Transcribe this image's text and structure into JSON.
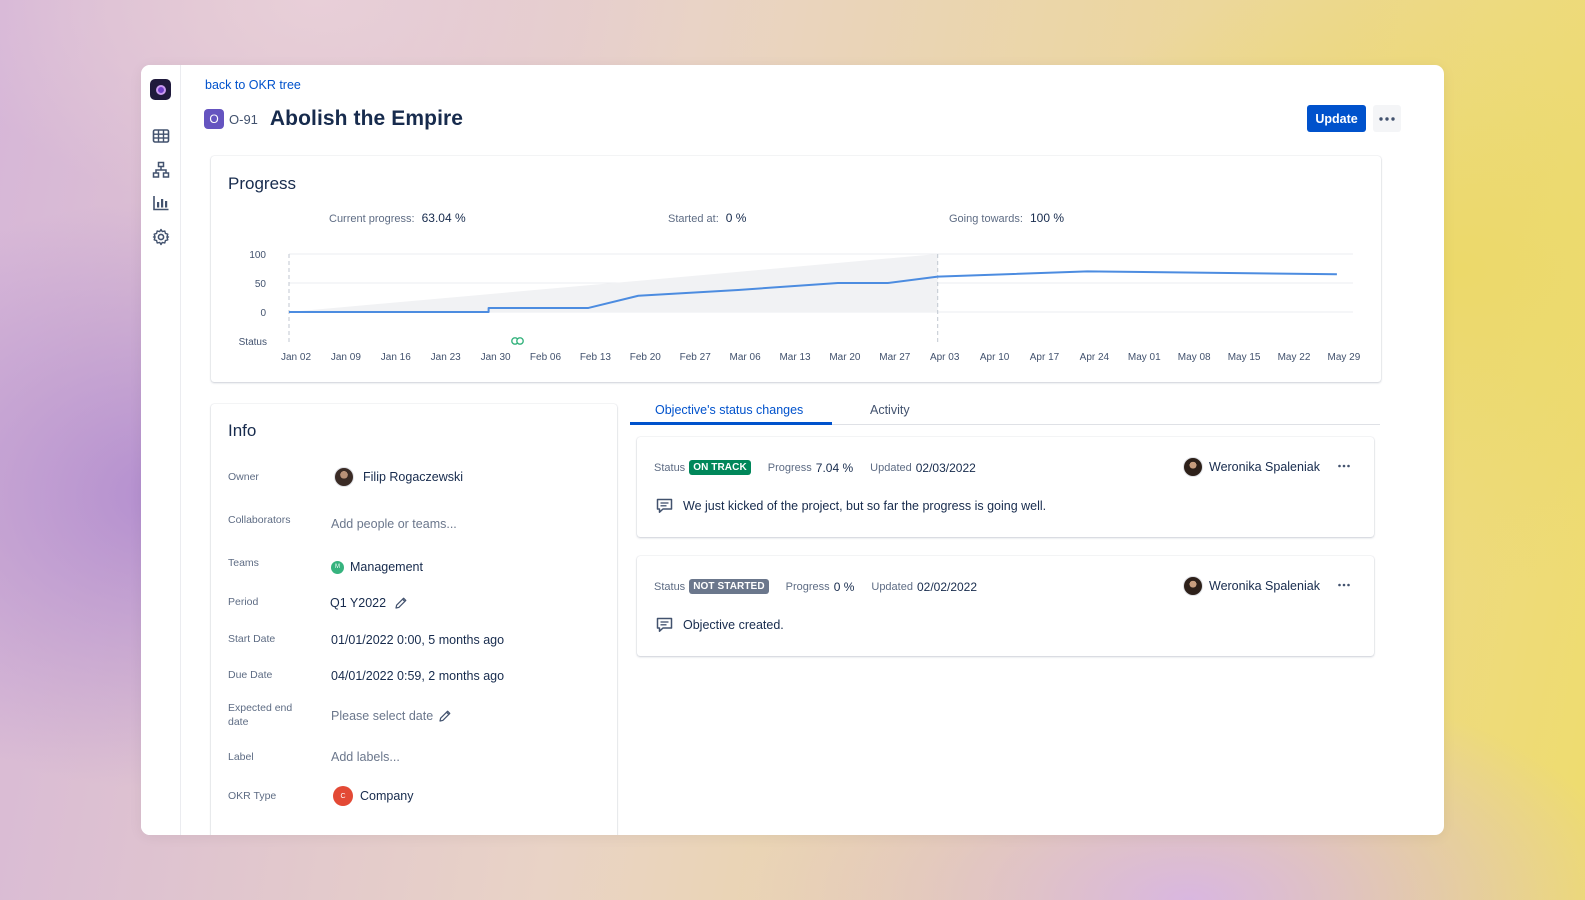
{
  "nav": {
    "back_link": "back to OKR tree"
  },
  "objective": {
    "badge": "O",
    "key": "O-91",
    "title": "Abolish the Empire"
  },
  "toolbar": {
    "update_label": "Update"
  },
  "progress": {
    "heading": "Progress",
    "current_label": "Current progress:",
    "current_value": "63.04 %",
    "started_label": "Started at:",
    "started_value": "0 %",
    "towards_label": "Going towards:",
    "towards_value": "100 %"
  },
  "chart_data": {
    "type": "line",
    "y_ticks": [
      "100",
      "50",
      "0"
    ],
    "status_label": "Status",
    "ylim": [
      0,
      100
    ],
    "x_labels": [
      "Jan 02",
      "Jan 09",
      "Jan 16",
      "Jan 23",
      "Jan 30",
      "Feb 06",
      "Feb 13",
      "Feb 20",
      "Feb 27",
      "Mar 06",
      "Mar 13",
      "Mar 20",
      "Mar 27",
      "Apr 03",
      "Apr 10",
      "Apr 17",
      "Apr 24",
      "May 01",
      "May 08",
      "May 15",
      "May 22",
      "May 29"
    ],
    "series": [
      {
        "points": [
          [
            "Jan 02",
            0
          ],
          [
            "Jan 30",
            0
          ],
          [
            "Jan 30",
            7
          ],
          [
            "Feb 13",
            7
          ],
          [
            "Feb 20",
            28
          ],
          [
            "Mar 06",
            38
          ],
          [
            "Mar 20",
            50
          ],
          [
            "Mar 27",
            50
          ],
          [
            "Apr 03",
            61
          ],
          [
            "Apr 24",
            70
          ],
          [
            "May 29",
            65
          ]
        ]
      }
    ],
    "expected_band": {
      "start": [
        "Jan 02",
        0
      ],
      "end": [
        "Apr 03",
        100
      ]
    },
    "period_markers": [
      "Jan 02",
      "Apr 03"
    ],
    "status_marker_dates": [
      "Feb 06"
    ],
    "status_marker_colors": [
      "#36b37e",
      "#36b37e"
    ],
    "line_color": "#4c8ce0",
    "band_color": "#f1f2f4",
    "grid": true
  },
  "info": {
    "heading": "Info",
    "rows": [
      {
        "label": "Owner",
        "value": "Filip Rogaczewski"
      },
      {
        "label": "Collaborators",
        "value": "Add people or teams..."
      },
      {
        "label": "Teams",
        "value": "Management",
        "dot": "M"
      },
      {
        "label": "Period",
        "value": "Q1 Y2022"
      },
      {
        "label": "Start Date",
        "value": "01/01/2022 0:00, 5 months ago"
      },
      {
        "label": "Due Date",
        "value": "04/01/2022 0:59, 2 months ago"
      },
      {
        "label": "Expected end date",
        "value": "Please select date"
      },
      {
        "label": "Label",
        "value": "Add labels..."
      },
      {
        "label": "OKR Type",
        "value": "Company",
        "dot": "C"
      }
    ]
  },
  "tabs": [
    {
      "label": "Objective's status changes",
      "active": true
    },
    {
      "label": "Activity",
      "active": false
    }
  ],
  "status_changes": [
    {
      "status_label": "Status",
      "status": "ON TRACK",
      "status_color": "#00875a",
      "progress_label": "Progress",
      "progress": "7.04 %",
      "updated_label": "Updated",
      "updated": "02/03/2022",
      "user": "Weronika Spaleniak",
      "comment": "We just kicked of the project, but so far the progress is going well."
    },
    {
      "status_label": "Status",
      "status": "NOT STARTED",
      "status_color": "#6b778c",
      "progress_label": "Progress",
      "progress": "0 %",
      "updated_label": "Updated",
      "updated": "02/02/2022",
      "user": "Weronika Spaleniak",
      "comment": "Objective created."
    }
  ]
}
